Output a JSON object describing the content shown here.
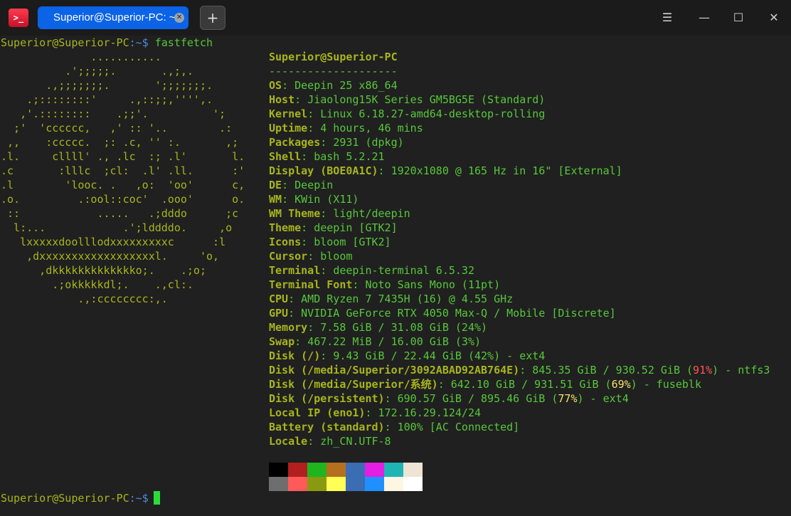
{
  "window": {
    "tab_title": "Superior@Superior-PC: ~",
    "app_icon": ">_",
    "new_tab_icon": "+",
    "menu_icon": "☰",
    "min_icon": "—",
    "max_icon": "☐",
    "close_icon": "✕"
  },
  "prompt": {
    "user": "Superior@Superior-PC",
    "sep": ":~$ ",
    "command": "fastfetch"
  },
  "logo_lines": [
    "              ...........",
    "          .';;;;;.       .,;,.",
    "       .,;;;;;;;.       ';;;;;;;.",
    "    .;::::::::'     .,::;;,'''',.",
    "   ,'.::::::::    .;;'.          ';",
    "  ;'  'cccccc,   ,' :: '..        .:",
    " ,,    :ccccc.  ;: .c, '' :.       ,;",
    ".l.     cllll' ., .lc  :; .l'       l.",
    ".c       :lllc  ;cl:  .l' .ll.      :'",
    ".l        'looc. .   ,o:  'oo'      c,",
    ".o.         .:ool::coc'  .ooo'      o.",
    " ::            .....   .;dddo      ;c",
    "  l:...            .';lddddo.     ,o",
    "   lxxxxxdoolllodxxxxxxxxxc      :l",
    "    ,dxxxxxxxxxxxxxxxxxxl.     'o,",
    "      ,dkkkkkkkkkkkkko;.    .;o;",
    "        .;okkkkkdl;.    .,cl:.",
    "            .,:cccccccc:,."
  ],
  "header": {
    "user_host": "Superior@Superior-PC",
    "separator": "--------------------"
  },
  "info": [
    {
      "key": "OS",
      "value": "Deepin 25 x86_64"
    },
    {
      "key": "Host",
      "value": "Jiaolong15K Series GM5BG5E (Standard)"
    },
    {
      "key": "Kernel",
      "value": "Linux 6.18.27-amd64-desktop-rolling"
    },
    {
      "key": "Uptime",
      "value": "4 hours, 46 mins"
    },
    {
      "key": "Packages",
      "value": "2931 (dpkg)"
    },
    {
      "key": "Shell",
      "value": "bash 5.2.21"
    },
    {
      "key": "Display (BOE0A1C)",
      "value": "1920x1080 @ 165 Hz in 16\" [External]"
    },
    {
      "key": "DE",
      "value": "Deepin"
    },
    {
      "key": "WM",
      "value": "KWin (X11)"
    },
    {
      "key": "WM Theme",
      "value": "light/deepin"
    },
    {
      "key": "Theme",
      "value": "deepin [GTK2]"
    },
    {
      "key": "Icons",
      "value": "bloom [GTK2]"
    },
    {
      "key": "Cursor",
      "value": "bloom"
    },
    {
      "key": "Terminal",
      "value": "deepin-terminal 6.5.32"
    },
    {
      "key": "Terminal Font",
      "value": "Noto Sans Mono (11pt)"
    },
    {
      "key": "CPU",
      "value": "AMD Ryzen 7 7435H (16) @ 4.55 GHz"
    },
    {
      "key": "GPU",
      "value": "NVIDIA GeForce RTX 4050 Max-Q / Mobile [Discrete]"
    },
    {
      "key": "Memory",
      "value": "7.58 GiB / 31.08 GiB (24%)"
    },
    {
      "key": "Swap",
      "value": "467.22 MiB / 16.00 GiB (3%)"
    },
    {
      "key": "Disk (/)",
      "value": "9.43 GiB / 22.44 GiB (42%) - ext4"
    },
    {
      "key": "Disk (/media/Superior/3092ABAD92AB764E)",
      "value_pre": "845.35 GiB / 930.52 GiB (",
      "pct": "91%",
      "pct_color": "red",
      "value_post": ") - ntfs3"
    },
    {
      "key": "Disk (/media/Superior/系统)",
      "value_pre": "642.10 GiB / 931.51 GiB (",
      "pct": "69%",
      "pct_color": "yellow",
      "value_post": ") - fuseblk"
    },
    {
      "key": "Disk (/persistent)",
      "value_pre": "690.57 GiB / 895.46 GiB (",
      "pct": "77%",
      "pct_color": "yellow",
      "value_post": ") - ext4"
    },
    {
      "key": "Local IP (eno1)",
      "value": "172.16.29.124/24"
    },
    {
      "key": "Battery (standard)",
      "value": "100% [AC Connected]"
    },
    {
      "key": "Locale",
      "value": "zh_CN.UTF-8"
    }
  ],
  "palette_top": [
    "#000000",
    "#b21f1f",
    "#1fb51f",
    "#b5701f",
    "#3a6db3",
    "#e21fe2",
    "#1fb5b5",
    "#ede4d3"
  ],
  "palette_bottom": [
    "#6e6e6e",
    "#ff5a5a",
    "#8a9a10",
    "#ffff55",
    "#3a6db3",
    "#1e90ff",
    "#fdf6e3",
    "#ffffff"
  ],
  "colors": {
    "accent_tab": "#0b63e6",
    "logo": "#a7b51c",
    "text_green": "#57c73a",
    "path_blue": "#4f8bd8",
    "cursor": "#2bdc39"
  }
}
